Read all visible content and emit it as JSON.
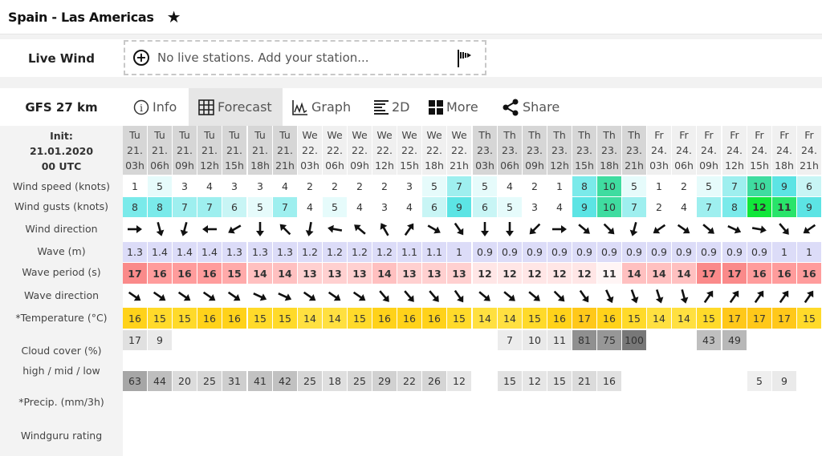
{
  "header": {
    "title": "Spain - Las Americas",
    "favorite_icon": "star-icon"
  },
  "live_wind": {
    "label": "Live Wind",
    "placeholder": "No live stations. Add your station...",
    "add_icon": "plus-circle-icon",
    "station_icon": "windsock-flag-icon"
  },
  "model": {
    "label": "GFS 27 km"
  },
  "tabs": [
    {
      "label": "Info",
      "icon": "info-icon",
      "active": false
    },
    {
      "label": "Forecast",
      "icon": "grid-icon",
      "active": true
    },
    {
      "label": "Graph",
      "icon": "graph-icon",
      "active": false
    },
    {
      "label": "2D",
      "icon": "2d-bars-icon",
      "active": false
    },
    {
      "label": "More",
      "icon": "tiles-icon",
      "active": false
    },
    {
      "label": "Share",
      "icon": "share-icon",
      "active": false
    }
  ],
  "init": {
    "line1": "Init:",
    "line2": "21.01.2020",
    "line3": "00 UTC"
  },
  "row_labels": {
    "wind_speed": "Wind speed (knots)",
    "wind_gusts": "Wind gusts (knots)",
    "wind_direction": "Wind direction",
    "wave": "Wave (m)",
    "wave_period": "Wave period (s)",
    "wave_direction": "Wave direction",
    "temperature": "*Temperature (°C)",
    "cloud_cover": "Cloud cover (%)",
    "cloud_levels": "high / mid / low",
    "precip": "*Precip. (mm/3h)",
    "rating": "Windguru rating"
  },
  "columns": [
    {
      "day": "Tu",
      "date": "21.",
      "hour": "03h",
      "shade": "dark"
    },
    {
      "day": "Tu",
      "date": "21.",
      "hour": "06h",
      "shade": "dark"
    },
    {
      "day": "Tu",
      "date": "21.",
      "hour": "09h",
      "shade": "dark"
    },
    {
      "day": "Tu",
      "date": "21.",
      "hour": "12h",
      "shade": "dark"
    },
    {
      "day": "Tu",
      "date": "21.",
      "hour": "15h",
      "shade": "dark"
    },
    {
      "day": "Tu",
      "date": "21.",
      "hour": "18h",
      "shade": "dark"
    },
    {
      "day": "Tu",
      "date": "21.",
      "hour": "21h",
      "shade": "dark"
    },
    {
      "day": "We",
      "date": "22.",
      "hour": "03h",
      "shade": "light"
    },
    {
      "day": "We",
      "date": "22.",
      "hour": "06h",
      "shade": "light"
    },
    {
      "day": "We",
      "date": "22.",
      "hour": "09h",
      "shade": "light"
    },
    {
      "day": "We",
      "date": "22.",
      "hour": "12h",
      "shade": "light"
    },
    {
      "day": "We",
      "date": "22.",
      "hour": "15h",
      "shade": "light"
    },
    {
      "day": "We",
      "date": "22.",
      "hour": "18h",
      "shade": "light"
    },
    {
      "day": "We",
      "date": "22.",
      "hour": "21h",
      "shade": "light"
    },
    {
      "day": "Th",
      "date": "23.",
      "hour": "03h",
      "shade": "dark"
    },
    {
      "day": "Th",
      "date": "23.",
      "hour": "06h",
      "shade": "dark"
    },
    {
      "day": "Th",
      "date": "23.",
      "hour": "09h",
      "shade": "dark"
    },
    {
      "day": "Th",
      "date": "23.",
      "hour": "12h",
      "shade": "dark"
    },
    {
      "day": "Th",
      "date": "23.",
      "hour": "15h",
      "shade": "dark"
    },
    {
      "day": "Th",
      "date": "23.",
      "hour": "18h",
      "shade": "dark"
    },
    {
      "day": "Th",
      "date": "23.",
      "hour": "21h",
      "shade": "dark"
    },
    {
      "day": "Fr",
      "date": "24.",
      "hour": "03h",
      "shade": "light"
    },
    {
      "day": "Fr",
      "date": "24.",
      "hour": "06h",
      "shade": "light"
    },
    {
      "day": "Fr",
      "date": "24.",
      "hour": "09h",
      "shade": "light"
    },
    {
      "day": "Fr",
      "date": "24.",
      "hour": "12h",
      "shade": "light"
    },
    {
      "day": "Fr",
      "date": "24.",
      "hour": "15h",
      "shade": "light"
    },
    {
      "day": "Fr",
      "date": "24.",
      "hour": "18h",
      "shade": "light"
    },
    {
      "day": "Fr",
      "date": "24.",
      "hour": "21h",
      "shade": "light"
    }
  ],
  "forecast": {
    "wind_speed": [
      1,
      5,
      3,
      4,
      3,
      3,
      4,
      2,
      2,
      2,
      2,
      3,
      5,
      7,
      5,
      4,
      2,
      1,
      8,
      10,
      5,
      1,
      2,
      5,
      7,
      10,
      9,
      6
    ],
    "wind_gusts": [
      8,
      8,
      7,
      7,
      6,
      5,
      7,
      4,
      5,
      4,
      3,
      4,
      6,
      9,
      6,
      5,
      3,
      4,
      9,
      10,
      7,
      2,
      4,
      7,
      8,
      12,
      11,
      9
    ],
    "wind_direction_deg": [
      0,
      75,
      105,
      180,
      150,
      90,
      225,
      100,
      190,
      220,
      240,
      305,
      30,
      55,
      90,
      90,
      135,
      0,
      40,
      45,
      105,
      145,
      35,
      40,
      25,
      10,
      50,
      145
    ],
    "wave_m": [
      "1.3",
      "1.4",
      "1.4",
      "1.4",
      "1.3",
      "1.3",
      "1.3",
      "1.2",
      "1.2",
      "1.2",
      "1.2",
      "1.1",
      "1.1",
      "1",
      "0.9",
      "0.9",
      "0.9",
      "0.9",
      "0.9",
      "0.9",
      "0.9",
      "0.9",
      "0.9",
      "0.9",
      "0.9",
      "0.9",
      "1",
      "1"
    ],
    "wave_period_s": [
      17,
      16,
      16,
      16,
      15,
      14,
      14,
      13,
      13,
      13,
      14,
      13,
      13,
      13,
      12,
      12,
      12,
      12,
      12,
      11,
      14,
      14,
      14,
      17,
      17,
      16,
      16,
      16
    ],
    "wave_direction_deg": [
      35,
      35,
      35,
      35,
      35,
      25,
      25,
      35,
      35,
      35,
      50,
      50,
      50,
      55,
      40,
      40,
      40,
      45,
      55,
      65,
      70,
      72,
      75,
      -55,
      -55,
      -55,
      -55,
      -55
    ],
    "temperature_c": [
      16,
      15,
      15,
      16,
      16,
      15,
      15,
      14,
      14,
      15,
      16,
      16,
      16,
      15,
      14,
      14,
      15,
      16,
      17,
      16,
      15,
      14,
      14,
      15,
      17,
      17,
      17,
      15
    ],
    "cloud_high": [
      17,
      9,
      null,
      null,
      null,
      null,
      null,
      null,
      null,
      null,
      null,
      null,
      null,
      null,
      null,
      7,
      10,
      11,
      81,
      75,
      100,
      null,
      null,
      43,
      49,
      null,
      null,
      null
    ],
    "cloud_mid": [
      null,
      null,
      null,
      null,
      null,
      null,
      null,
      null,
      null,
      null,
      null,
      null,
      null,
      null,
      null,
      null,
      null,
      null,
      null,
      null,
      null,
      null,
      null,
      null,
      null,
      null,
      null,
      null
    ],
    "cloud_low": [
      63,
      44,
      20,
      25,
      31,
      41,
      42,
      25,
      18,
      25,
      29,
      22,
      26,
      12,
      null,
      15,
      12,
      15,
      21,
      16,
      null,
      null,
      null,
      null,
      null,
      5,
      9,
      null
    ],
    "precip": [
      null,
      null,
      null,
      null,
      null,
      null,
      null,
      null,
      null,
      null,
      null,
      null,
      null,
      null,
      null,
      null,
      null,
      null,
      null,
      null,
      null,
      null,
      null,
      null,
      null,
      null,
      null,
      null
    ],
    "rating": [
      null,
      null,
      null,
      null,
      null,
      null,
      null,
      null,
      null,
      null,
      null,
      null,
      null,
      null,
      null,
      null,
      null,
      null,
      null,
      null,
      null,
      null,
      null,
      null,
      null,
      null,
      null,
      null
    ]
  },
  "colors": {
    "header_dark": "#d6d6d6",
    "header_light": "#f0f0f0",
    "left_panel": "#f3f3f3",
    "tab_active": "#e6e6e6",
    "wave_bg": "#dcdcf8"
  }
}
